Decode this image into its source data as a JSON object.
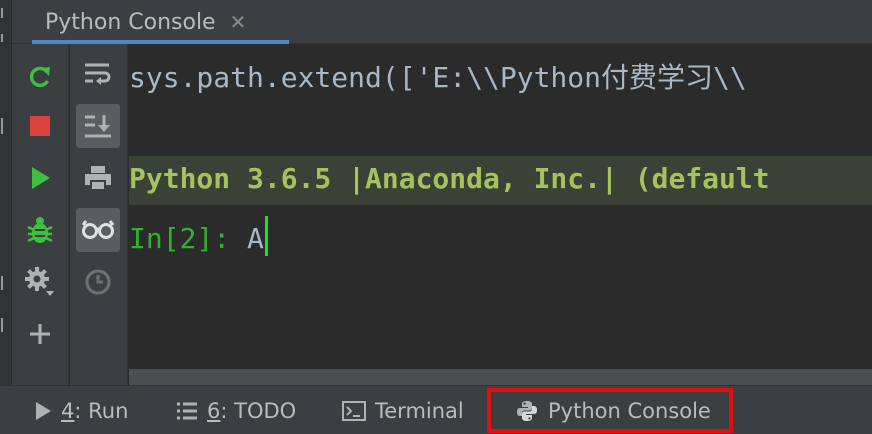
{
  "tab": {
    "title": "Python Console",
    "close_glyph": "✕"
  },
  "console": {
    "line1": "sys.path.extend(['E:\\\\Python付费学习\\\\",
    "banner": "Python 3.6.5 |Anaconda, Inc.| (default",
    "prompt": "In[2]: ",
    "input": "A"
  },
  "toolbar_left": [
    "rerun-icon",
    "stop-icon",
    "run-icon",
    "debug-icon",
    "settings-icon",
    "add-icon"
  ],
  "toolbar_right": [
    "soft-wrap-icon",
    "scroll-to-end-icon",
    "print-icon",
    "variables-icon",
    "history-icon"
  ],
  "bottom_bar": {
    "run": {
      "mnemonic": "4",
      "label": ": Run"
    },
    "todo": {
      "mnemonic": "6",
      "label": ": TODO"
    },
    "terminal": {
      "label": "Terminal"
    },
    "python_console": {
      "label": "Python Console"
    }
  },
  "colors": {
    "accent": "#4a88c7",
    "highlight_border": "#e01010",
    "prompt_green": "#30b130",
    "banner_text": "#a5c25c",
    "caret": "#1fe01f"
  }
}
